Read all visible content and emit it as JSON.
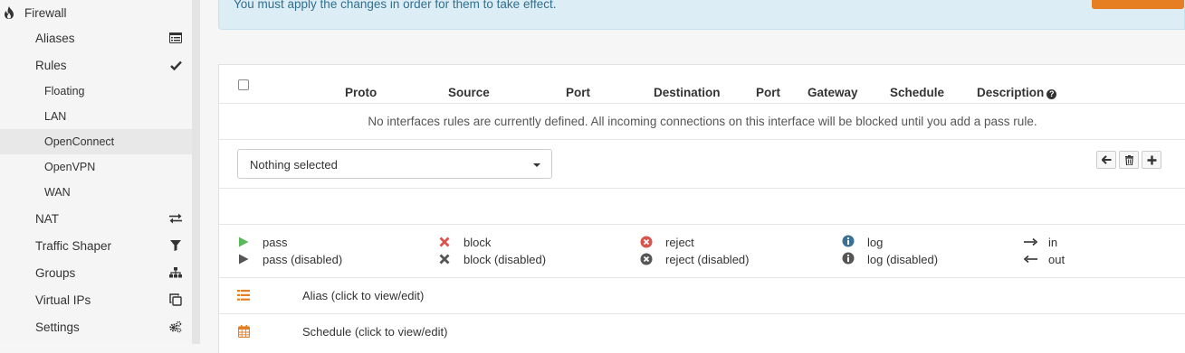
{
  "sidebar": {
    "top": {
      "label": "Firewall",
      "icon": "fire-icon"
    },
    "items": [
      {
        "label": "Aliases",
        "icon": "list-alt-icon"
      },
      {
        "label": "Rules",
        "icon": "check-icon"
      },
      {
        "label": "Floating"
      },
      {
        "label": "LAN"
      },
      {
        "label": "OpenConnect",
        "selected": true
      },
      {
        "label": "OpenVPN"
      },
      {
        "label": "WAN"
      },
      {
        "label": "NAT",
        "icon": "exchange-icon"
      },
      {
        "label": "Traffic Shaper",
        "icon": "filter-icon"
      },
      {
        "label": "Groups",
        "icon": "sitemap-icon"
      },
      {
        "label": "Virtual IPs",
        "icon": "clone-icon"
      },
      {
        "label": "Settings",
        "icon": "cogs-icon"
      }
    ]
  },
  "alert": {
    "text": "You must apply the changes in order for them to take effect.",
    "apply_color": "#e67e22"
  },
  "table": {
    "headers": [
      "Proto",
      "Source",
      "Port",
      "Destination",
      "Port",
      "Gateway",
      "Schedule",
      "Description"
    ],
    "empty_message": "No interfaces rules are currently defined. All incoming connections on this interface will be blocked until you add a pass rule."
  },
  "filter": {
    "select_value": "Nothing selected"
  },
  "toolbar": {
    "icons": [
      "arrow-left-icon",
      "trash-icon",
      "plus-icon"
    ]
  },
  "legend": {
    "pass": "pass",
    "pass_disabled": "pass (disabled)",
    "block": "block",
    "block_disabled": "block (disabled)",
    "reject": "reject",
    "reject_disabled": "reject (disabled)",
    "log": "log",
    "log_disabled": "log (disabled)",
    "in": "in",
    "out": "out"
  },
  "footer": {
    "alias": "Alias (click to view/edit)",
    "schedule": "Schedule (click to view/edit)"
  },
  "colors": {
    "pass": "#5cb85c",
    "block": "#d9534f",
    "reject": "#d9534f",
    "log": "#3a6f96",
    "disabled": "#555555",
    "accent": "#e67e22",
    "alert_bg": "#dcedf5",
    "alert_text": "#31708f"
  }
}
